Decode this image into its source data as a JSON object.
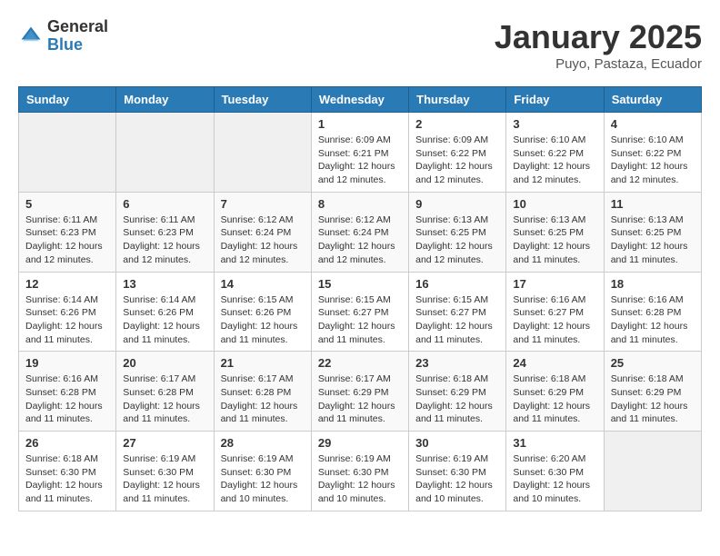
{
  "header": {
    "logo_general": "General",
    "logo_blue": "Blue",
    "month_title": "January 2025",
    "location": "Puyo, Pastaza, Ecuador"
  },
  "days_of_week": [
    "Sunday",
    "Monday",
    "Tuesday",
    "Wednesday",
    "Thursday",
    "Friday",
    "Saturday"
  ],
  "weeks": [
    [
      {
        "day": "",
        "info": ""
      },
      {
        "day": "",
        "info": ""
      },
      {
        "day": "",
        "info": ""
      },
      {
        "day": "1",
        "info": "Sunrise: 6:09 AM\nSunset: 6:21 PM\nDaylight: 12 hours\nand 12 minutes."
      },
      {
        "day": "2",
        "info": "Sunrise: 6:09 AM\nSunset: 6:22 PM\nDaylight: 12 hours\nand 12 minutes."
      },
      {
        "day": "3",
        "info": "Sunrise: 6:10 AM\nSunset: 6:22 PM\nDaylight: 12 hours\nand 12 minutes."
      },
      {
        "day": "4",
        "info": "Sunrise: 6:10 AM\nSunset: 6:22 PM\nDaylight: 12 hours\nand 12 minutes."
      }
    ],
    [
      {
        "day": "5",
        "info": "Sunrise: 6:11 AM\nSunset: 6:23 PM\nDaylight: 12 hours\nand 12 minutes."
      },
      {
        "day": "6",
        "info": "Sunrise: 6:11 AM\nSunset: 6:23 PM\nDaylight: 12 hours\nand 12 minutes."
      },
      {
        "day": "7",
        "info": "Sunrise: 6:12 AM\nSunset: 6:24 PM\nDaylight: 12 hours\nand 12 minutes."
      },
      {
        "day": "8",
        "info": "Sunrise: 6:12 AM\nSunset: 6:24 PM\nDaylight: 12 hours\nand 12 minutes."
      },
      {
        "day": "9",
        "info": "Sunrise: 6:13 AM\nSunset: 6:25 PM\nDaylight: 12 hours\nand 12 minutes."
      },
      {
        "day": "10",
        "info": "Sunrise: 6:13 AM\nSunset: 6:25 PM\nDaylight: 12 hours\nand 11 minutes."
      },
      {
        "day": "11",
        "info": "Sunrise: 6:13 AM\nSunset: 6:25 PM\nDaylight: 12 hours\nand 11 minutes."
      }
    ],
    [
      {
        "day": "12",
        "info": "Sunrise: 6:14 AM\nSunset: 6:26 PM\nDaylight: 12 hours\nand 11 minutes."
      },
      {
        "day": "13",
        "info": "Sunrise: 6:14 AM\nSunset: 6:26 PM\nDaylight: 12 hours\nand 11 minutes."
      },
      {
        "day": "14",
        "info": "Sunrise: 6:15 AM\nSunset: 6:26 PM\nDaylight: 12 hours\nand 11 minutes."
      },
      {
        "day": "15",
        "info": "Sunrise: 6:15 AM\nSunset: 6:27 PM\nDaylight: 12 hours\nand 11 minutes."
      },
      {
        "day": "16",
        "info": "Sunrise: 6:15 AM\nSunset: 6:27 PM\nDaylight: 12 hours\nand 11 minutes."
      },
      {
        "day": "17",
        "info": "Sunrise: 6:16 AM\nSunset: 6:27 PM\nDaylight: 12 hours\nand 11 minutes."
      },
      {
        "day": "18",
        "info": "Sunrise: 6:16 AM\nSunset: 6:28 PM\nDaylight: 12 hours\nand 11 minutes."
      }
    ],
    [
      {
        "day": "19",
        "info": "Sunrise: 6:16 AM\nSunset: 6:28 PM\nDaylight: 12 hours\nand 11 minutes."
      },
      {
        "day": "20",
        "info": "Sunrise: 6:17 AM\nSunset: 6:28 PM\nDaylight: 12 hours\nand 11 minutes."
      },
      {
        "day": "21",
        "info": "Sunrise: 6:17 AM\nSunset: 6:28 PM\nDaylight: 12 hours\nand 11 minutes."
      },
      {
        "day": "22",
        "info": "Sunrise: 6:17 AM\nSunset: 6:29 PM\nDaylight: 12 hours\nand 11 minutes."
      },
      {
        "day": "23",
        "info": "Sunrise: 6:18 AM\nSunset: 6:29 PM\nDaylight: 12 hours\nand 11 minutes."
      },
      {
        "day": "24",
        "info": "Sunrise: 6:18 AM\nSunset: 6:29 PM\nDaylight: 12 hours\nand 11 minutes."
      },
      {
        "day": "25",
        "info": "Sunrise: 6:18 AM\nSunset: 6:29 PM\nDaylight: 12 hours\nand 11 minutes."
      }
    ],
    [
      {
        "day": "26",
        "info": "Sunrise: 6:18 AM\nSunset: 6:30 PM\nDaylight: 12 hours\nand 11 minutes."
      },
      {
        "day": "27",
        "info": "Sunrise: 6:19 AM\nSunset: 6:30 PM\nDaylight: 12 hours\nand 11 minutes."
      },
      {
        "day": "28",
        "info": "Sunrise: 6:19 AM\nSunset: 6:30 PM\nDaylight: 12 hours\nand 10 minutes."
      },
      {
        "day": "29",
        "info": "Sunrise: 6:19 AM\nSunset: 6:30 PM\nDaylight: 12 hours\nand 10 minutes."
      },
      {
        "day": "30",
        "info": "Sunrise: 6:19 AM\nSunset: 6:30 PM\nDaylight: 12 hours\nand 10 minutes."
      },
      {
        "day": "31",
        "info": "Sunrise: 6:20 AM\nSunset: 6:30 PM\nDaylight: 12 hours\nand 10 minutes."
      },
      {
        "day": "",
        "info": ""
      }
    ]
  ]
}
